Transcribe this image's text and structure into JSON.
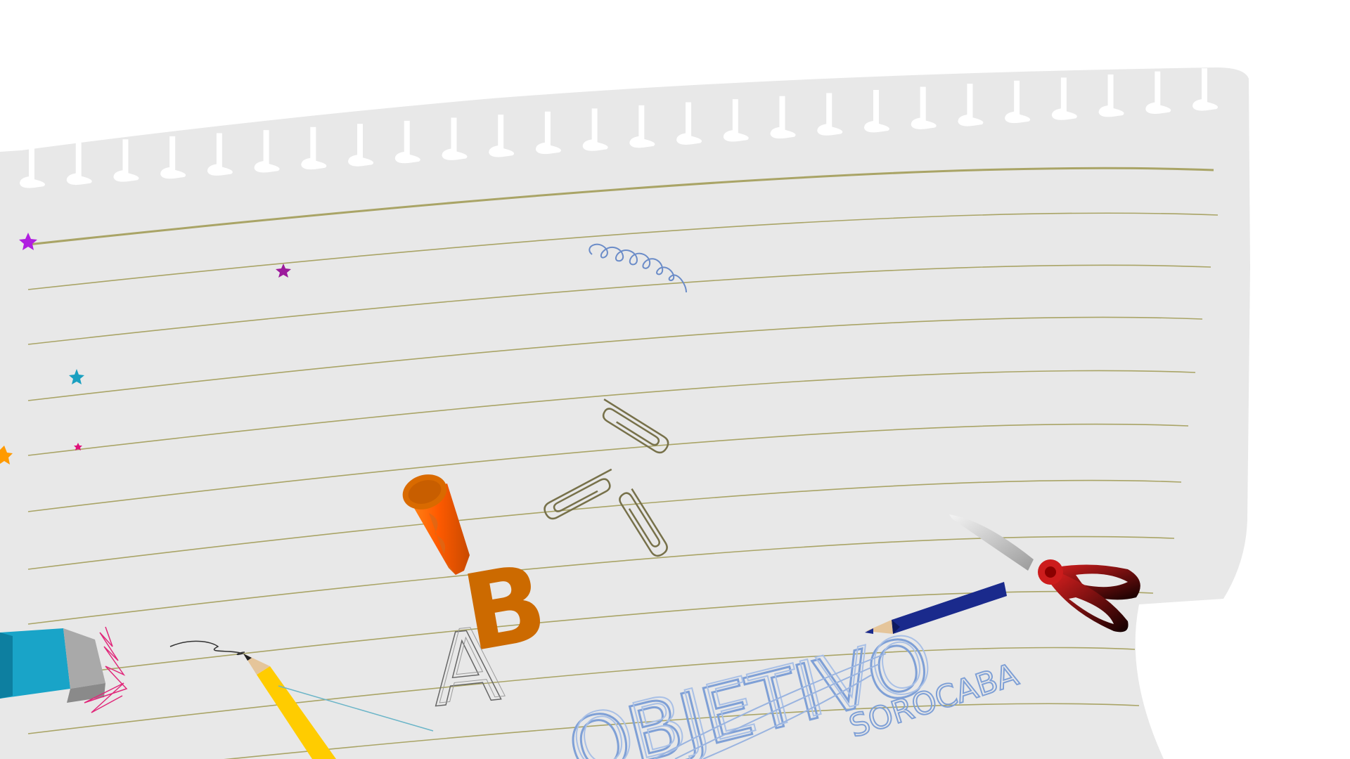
{
  "scene": {
    "title": "",
    "colors": {
      "paper": "#e8e8e8",
      "ruling": "#a9a466",
      "sketch_blue": "#7fa0d6",
      "pen_blue": "#5b7ec4",
      "crayon_orange": "#e66a00",
      "letter_b": "#cc6a00",
      "eraser_cyan": "#19a4c8",
      "pencil_yellow": "#ffcc00",
      "scissors_red": "#cc1c1c"
    },
    "icons": [
      "notebook-paper-icon",
      "star-icon",
      "squiggle-icon",
      "paperclip-icon",
      "crayon-icon",
      "letter-b-icon",
      "letter-a-icon",
      "eraser-icon",
      "pencil-icon",
      "blue-pencil-icon",
      "scissors-icon"
    ],
    "text": {
      "logo_main": "OBJETIVO",
      "logo_sub": "SOROCABA",
      "letter_b": "B",
      "letter_a": "A"
    }
  }
}
